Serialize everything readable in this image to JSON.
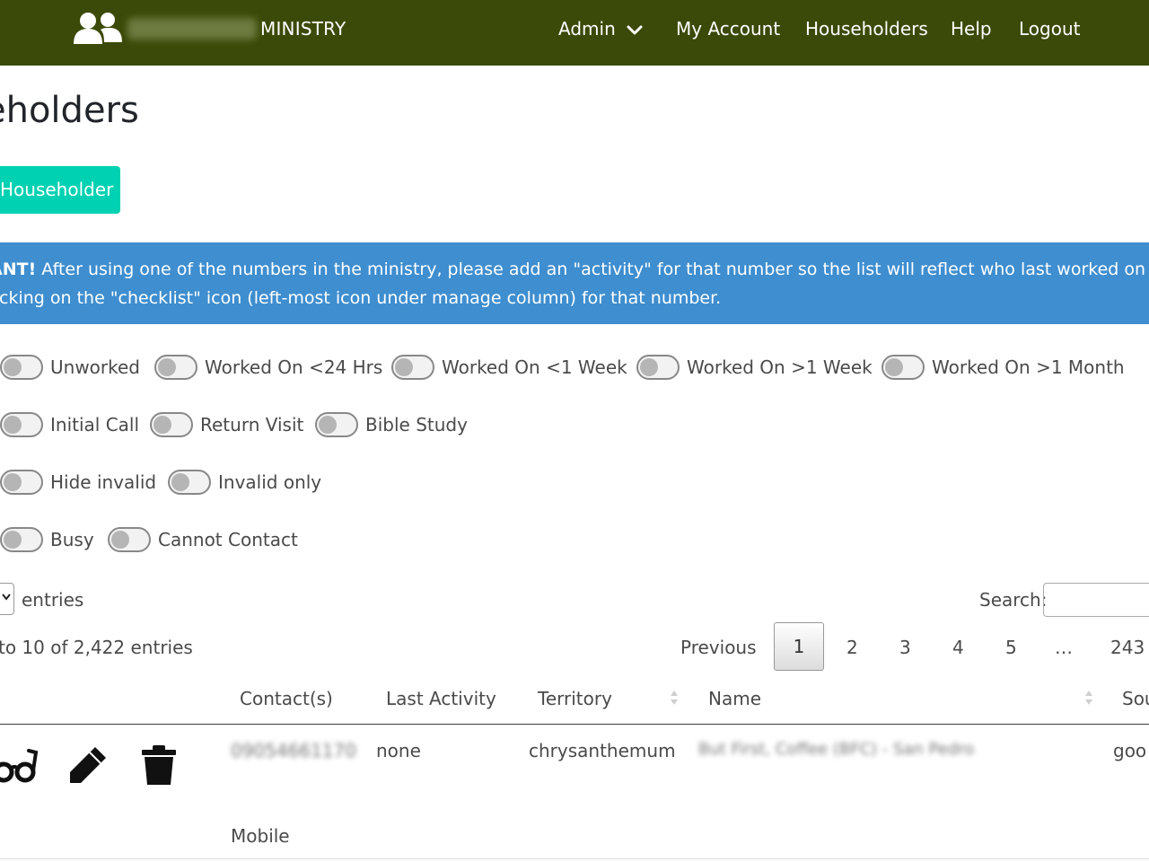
{
  "nav": {
    "brand_blurred": "NWSoutheast",
    "brand": "MINISTRY",
    "links": [
      "Admin",
      "My Account",
      "Householders",
      "Help",
      "Logout"
    ]
  },
  "page": {
    "title": "eholders",
    "add_button": "Householder"
  },
  "notice": {
    "bold": "ANT!",
    "line1": "After using one of the numbers in the ministry, please add an \"activity\" for that number so the list will reflect who last worked on it. You",
    "line2": "clicking on the \"checklist\" icon (left-most icon under manage column) for that number."
  },
  "filters": {
    "row1": [
      "Unworked",
      "Worked On <24 Hrs",
      "Worked On <1 Week",
      "Worked On >1 Week",
      "Worked On >1 Month"
    ],
    "row2": [
      "Initial Call",
      "Return Visit",
      "Bible Study"
    ],
    "row3": [
      "Hide invalid",
      "Invalid only"
    ],
    "row4": [
      "Busy",
      "Cannot Contact"
    ]
  },
  "table_controls": {
    "entries_label": "entries",
    "search_label": "Search:",
    "info": "to 10 of 2,422 entries",
    "pagination": {
      "previous": "Previous",
      "pages": [
        "1",
        "2",
        "3",
        "4",
        "5",
        "…",
        "243"
      ],
      "current": "1"
    }
  },
  "table": {
    "headers": [
      "Contact(s)",
      "Last Activity",
      "Territory",
      "Name",
      "Sou"
    ],
    "rows": [
      {
        "contact": "09054661170",
        "contact_type": "Mobile",
        "last_activity": "none",
        "territory": "chrysanthemum",
        "name": "But First, Coffee (BFC) - San Pedro",
        "source": "goo"
      }
    ]
  },
  "icons": [
    "users-icon",
    "chevron-down-icon",
    "glasses-icon",
    "pencil-icon",
    "trash-icon",
    "sort-icon"
  ],
  "colors": {
    "navbar": "#3b4a08",
    "add_button": "#00d1b2",
    "notice": "#3e8ed0"
  }
}
